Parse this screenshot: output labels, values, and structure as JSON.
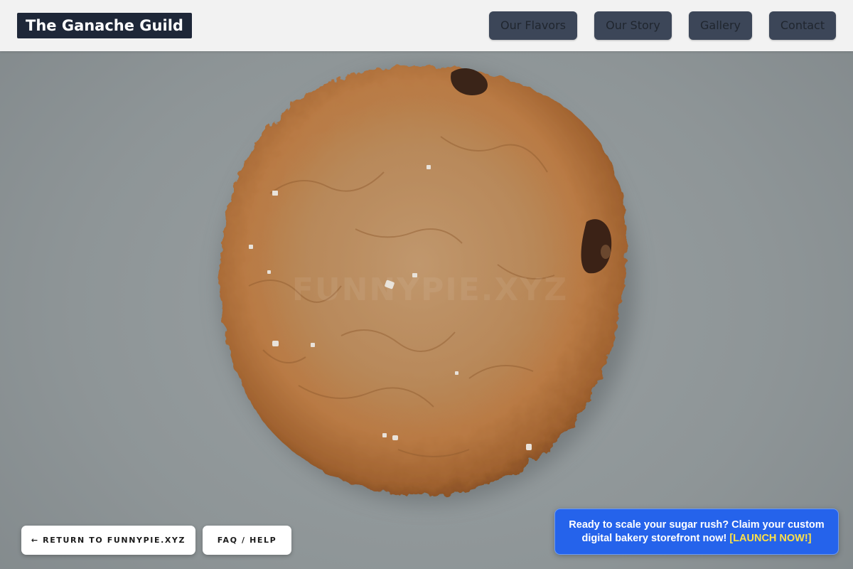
{
  "header": {
    "brand": "The Ganache Guild",
    "nav": [
      {
        "label": "Our Flavors"
      },
      {
        "label": "Our Story"
      },
      {
        "label": "Gallery"
      },
      {
        "label": "Contact"
      }
    ]
  },
  "hero": {
    "image": "chocolate-chip-cookie-photo",
    "watermark": "FUNNYPIE.XYZ"
  },
  "footer_buttons": {
    "return_label": "← RETURN TO FUNNYPIE.XYZ",
    "faq_label": "FAQ / HELP"
  },
  "promo": {
    "text": "Ready to scale your sugar rush? Claim your custom digital bakery storefront now!",
    "cta": "[LAUNCH NOW!]"
  },
  "colors": {
    "brand_bg": "#1e2738",
    "nav_bg": "#3c4658",
    "promo_bg": "#2563eb",
    "promo_cta": "#fde047"
  }
}
